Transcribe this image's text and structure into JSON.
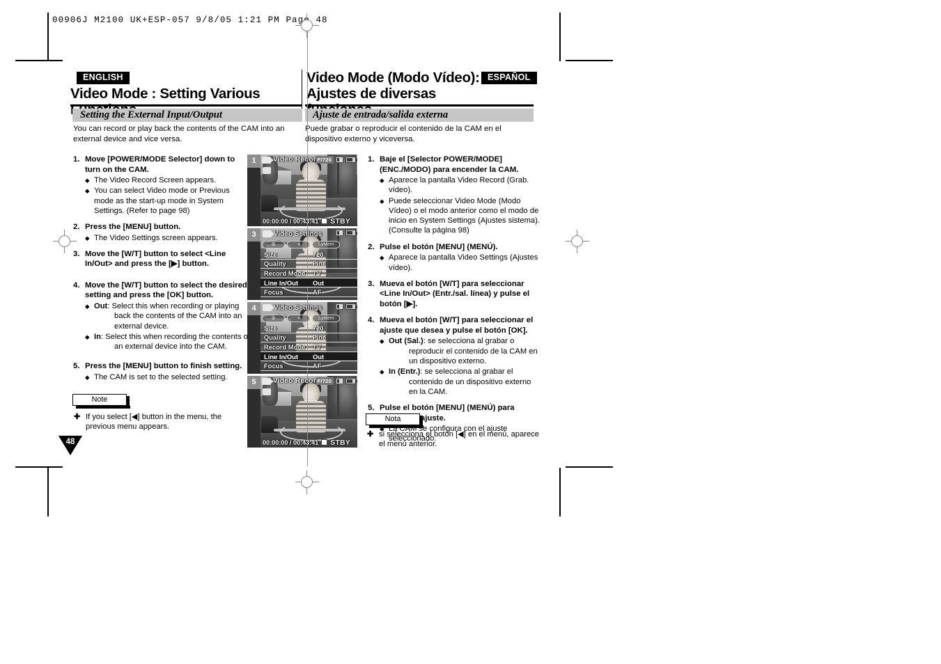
{
  "prepress": {
    "slug": "00906J M2100 UK+ESP-057   9/8/05 1:21 PM   Page 48"
  },
  "english": {
    "badge": "ENGLISH",
    "title": "Video Mode : Setting Various Functions",
    "subhead": "Setting the External Input/Output",
    "intro": "You can record or play back the contents of the CAM into an external device and vice versa.",
    "steps": [
      {
        "num": "1.",
        "text": "Move [POWER/MODE Selector] down to turn on the CAM.",
        "bullets": [
          "The Video Record Screen appears.",
          "You can select Video mode or Previous mode as the start-up mode in System Settings. (Refer to page 98)"
        ]
      },
      {
        "num": "2.",
        "text": "Press the [MENU] button.",
        "bullets": [
          "The Video Settings screen appears."
        ]
      },
      {
        "num": "3.",
        "text": "Move the [W/T] button to select <Line In/Out> and press the [▶] button.",
        "bullets": []
      },
      {
        "num": "4.",
        "text": "Move the [W/T] button to select the desired setting and press the [OK] button.",
        "bullets": []
      },
      {
        "num": "5.",
        "text": "Press the [MENU] button to finish setting.",
        "bullets": [
          "The CAM is set to the selected setting."
        ]
      }
    ],
    "step4_options": [
      {
        "name": "Out",
        "desc": ": Select this when recording or playing",
        "cont": "back the contents of the CAM into an external device."
      },
      {
        "name": "In",
        "desc": ": Select this when recording the contents of",
        "cont": "an external device into the CAM."
      }
    ],
    "note_label": "Note",
    "note_text": "If you select [◀] button in the menu, the previous menu appears.",
    "page_number": "48"
  },
  "spanish": {
    "badge": "ESPAÑOL",
    "title_line1": "Video Mode (Modo Vídeo):",
    "title_line2": "Ajustes de diversas funciones",
    "subhead": "Ajuste de entrada/salida externa",
    "intro": "Puede grabar o reproducir el contenido de la CAM en el dispositivo externo y viceversa.",
    "steps": [
      {
        "num": "1.",
        "text": "Baje el [Selector POWER/MODE] (ENC./MODO) para encender la CAM.",
        "bullets": [
          "Aparece la pantalla Video Record (Grab. vídeo).",
          "Puede seleccionar Video Mode (Modo Vídeo) o el modo anterior como el modo de inicio en System Settings (Ajustes sistema). (Consulte la página 98)"
        ]
      },
      {
        "num": "2.",
        "text": "Pulse el botón [MENU] (MENÚ).",
        "bullets": [
          "Aparece la pantalla Video Settings (Ajustes vídeo)."
        ]
      },
      {
        "num": "3.",
        "text": "Mueva el botón [W/T] para seleccionar <Line In/Out> (Entr./sal. línea) y pulse el botón [▶].",
        "bullets": []
      },
      {
        "num": "4.",
        "text": "Mueva el botón [W/T] para seleccionar el ajuste que desea y pulse el botón [OK].",
        "bullets": []
      },
      {
        "num": "5.",
        "text": "Pulse el botón [MENU] (MENÚ) para finalizar el ajuste.",
        "bullets": [
          "La CAM se configura con el ajuste seleccionado."
        ]
      }
    ],
    "step4_options": [
      {
        "name": "Out (Sal.)",
        "desc": ": se selecciona al grabar o",
        "cont": "reproducir el contenido de la CAM en un dispositivo externo."
      },
      {
        "name": "In (Entr.)",
        "desc": ": se selecciona al grabar el",
        "cont": "contenido de un dispositivo externo en la CAM."
      }
    ],
    "note_label": "Nota",
    "note_text": "si selecciona el botón [◀] en el menú, aparece el menú anterior."
  },
  "screenshots": [
    {
      "badge": "1",
      "type": "record",
      "osd_title": "Video Record",
      "resolution": "F/720",
      "timecode": "00:00:00 / 00:43:41",
      "status": "STBY"
    },
    {
      "badge": "3",
      "type": "menu",
      "osd_title": "Video Settings",
      "tabs": [
        "⚙",
        "◑",
        "System"
      ],
      "rows": [
        {
          "label": "Size",
          "value": "720",
          "active": false
        },
        {
          "label": "Quality",
          "value": "Fine",
          "active": false
        },
        {
          "label": "Record Mode",
          "value": "TV",
          "active": false
        },
        {
          "label": "Line In/Out",
          "value": "Out",
          "active": true
        },
        {
          "label": "Focus",
          "value": "AF",
          "active": false
        }
      ]
    },
    {
      "badge": "4",
      "type": "menu",
      "osd_title": "Video Settings",
      "tabs": [
        "⚙",
        "◑",
        "System"
      ],
      "rows": [
        {
          "label": "Size",
          "value": "720",
          "active": false
        },
        {
          "label": "Quality",
          "value": "Fine",
          "active": false
        },
        {
          "label": "Record Mode",
          "value": "TV",
          "active": false
        },
        {
          "label": "Line In/Out",
          "value": "Out",
          "active": true
        },
        {
          "label": "Focus",
          "value": "AF",
          "active": false
        }
      ]
    },
    {
      "badge": "5",
      "type": "record",
      "osd_title": "Video Record",
      "resolution": "F/720",
      "timecode": "00:00:00 / 00:43:41",
      "status": "STBY"
    }
  ]
}
